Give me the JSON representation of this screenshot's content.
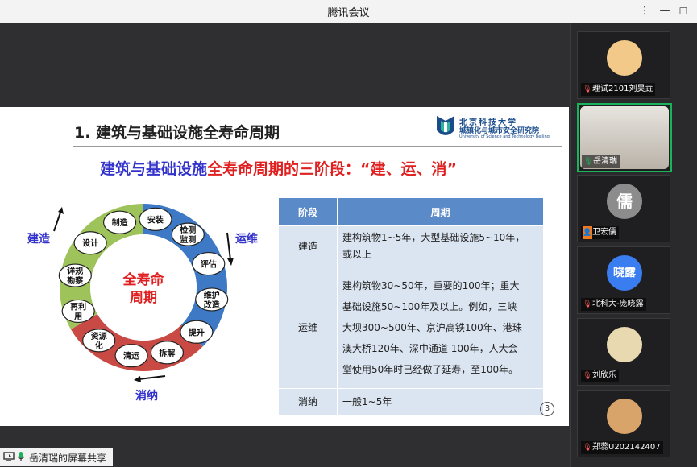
{
  "window": {
    "title": "腾讯会议"
  },
  "slide": {
    "title": "1. 建筑与基础设施全寿命周期",
    "logo": {
      "cn1": "北京科技大学",
      "cn2": "城镇化与城市安全研究院",
      "en": "University of Science and Technology Beijing"
    },
    "subtitle_blue": "建筑与基础设施",
    "subtitle_red": "全寿命周期的三阶段：“建、运、消”",
    "cycle": {
      "center_line1": "全寿命",
      "center_line2": "周期",
      "phase_build": "建造",
      "phase_operate": "运维",
      "phase_dispose": "消纳",
      "nodes": [
        {
          "line1": "安装",
          "line2": ""
        },
        {
          "line1": "检测",
          "line2": "监测"
        },
        {
          "line1": "评估",
          "line2": ""
        },
        {
          "line1": "维护",
          "line2": "改造"
        },
        {
          "line1": "提升",
          "line2": ""
        },
        {
          "line1": "拆解",
          "line2": ""
        },
        {
          "line1": "清运",
          "line2": ""
        },
        {
          "line1": "资源",
          "line2": "化"
        },
        {
          "line1": "再利",
          "line2": "用"
        },
        {
          "line1": "详规",
          "line2": "勘察"
        },
        {
          "line1": "设计",
          "line2": ""
        },
        {
          "line1": "制造",
          "line2": ""
        }
      ]
    },
    "table": {
      "headers": [
        "阶段",
        "周期"
      ],
      "rows": [
        {
          "stage": "建造",
          "lines": [
            "建构筑物1~5年，大型基础设施5~10年，",
            "或以上"
          ]
        },
        {
          "stage": "运维",
          "lines": [
            "建构筑物30~50年，重要的100年；重大",
            "基础设施50~100年及以上。例如，三峡",
            "大坝300~500年、京沪高铁100年、港珠",
            "澳大桥120年、深中通道 100年，人大会",
            "堂使用50年时已经做了延寿，至100年。"
          ]
        },
        {
          "stage": "消纳",
          "lines": [
            "一般1~5年"
          ]
        }
      ]
    },
    "page_number": "3"
  },
  "share_bar": {
    "text": "岳清瑞的屏幕共享"
  },
  "participants": [
    {
      "name": "理试2101刘昊垚",
      "mic": "muted",
      "avatar_color": "#f3c98a",
      "avatar_text": ""
    },
    {
      "name": "岳清瑞",
      "mic": "on",
      "avatar_color": "#cfc9c0",
      "avatar_text": ""
    },
    {
      "name": "卫宏儒",
      "mic": "badge",
      "avatar_color": "#8c8c8c",
      "avatar_text": "儒"
    },
    {
      "name": "北科大-庞晓露",
      "mic": "muted",
      "avatar_color": "#3a7df0",
      "avatar_text": "晓露"
    },
    {
      "name": "刘欣乐",
      "mic": "muted",
      "avatar_color": "#e8d9b0",
      "avatar_text": ""
    },
    {
      "name": "郑蕊U202142407",
      "mic": "muted",
      "avatar_color": "#d9a46a",
      "avatar_text": ""
    }
  ],
  "colors": {
    "active_speaker": "#18b35a",
    "table_header": "#5b8ac9",
    "table_cell": "#dbe4f1",
    "ring_green": "#9dc35a",
    "ring_blue": "#3d79c5",
    "ring_red": "#c94a45"
  }
}
